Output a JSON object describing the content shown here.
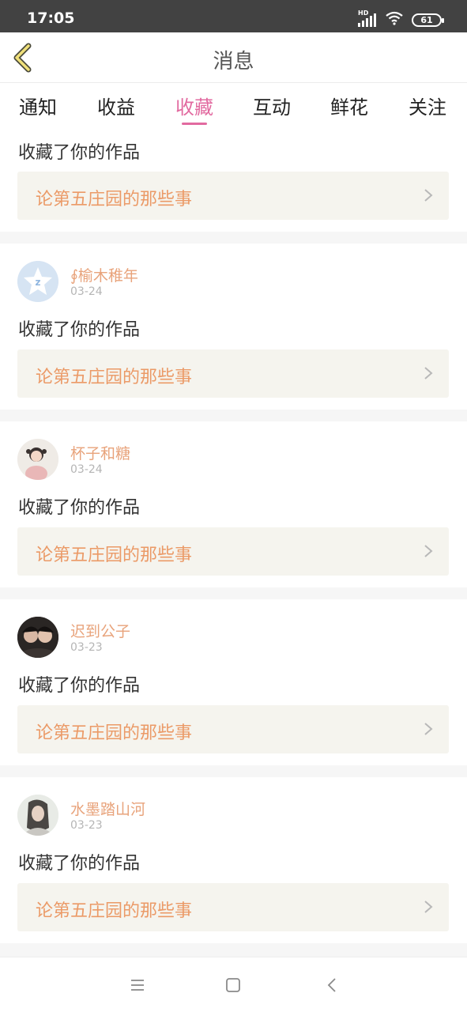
{
  "status_bar": {
    "time": "17:05",
    "network": "HD",
    "battery": "61",
    "icons": [
      "signal-icon",
      "wifi-icon",
      "battery-icon"
    ]
  },
  "header": {
    "title": "消息",
    "back_icon": "chevron-left-icon"
  },
  "tabs": [
    {
      "label": "通知",
      "active": false
    },
    {
      "label": "收益",
      "active": false
    },
    {
      "label": "收藏",
      "active": true
    },
    {
      "label": "互动",
      "active": false
    },
    {
      "label": "鲜花",
      "active": false
    },
    {
      "label": "关注",
      "active": false
    }
  ],
  "colors": {
    "accent": "#e26aa0",
    "username": "#e8a37b",
    "work_title": "#eb9a67",
    "link_bg": "#f5f4ee",
    "status_bar": "#424242"
  },
  "notifications": [
    {
      "user": "",
      "date": "",
      "action": "收藏了你的作品",
      "work": "论第五庄园的那些事"
    },
    {
      "user": "∮榆木稚年",
      "date": "03-24",
      "action": "收藏了你的作品",
      "work": "论第五庄园的那些事",
      "avatar": "qzone-star-icon"
    },
    {
      "user": "杯子和糖",
      "date": "03-24",
      "action": "收藏了你的作品",
      "work": "论第五庄园的那些事",
      "avatar": "user-avatar"
    },
    {
      "user": "迟到公子",
      "date": "03-23",
      "action": "收藏了你的作品",
      "work": "论第五庄园的那些事",
      "avatar": "user-avatar"
    },
    {
      "user": "水墨踏山河",
      "date": "03-23",
      "action": "收藏了你的作品",
      "work": "论第五庄园的那些事",
      "avatar": "user-avatar"
    }
  ],
  "system_nav": [
    "menu-icon",
    "home-icon",
    "back-icon"
  ]
}
